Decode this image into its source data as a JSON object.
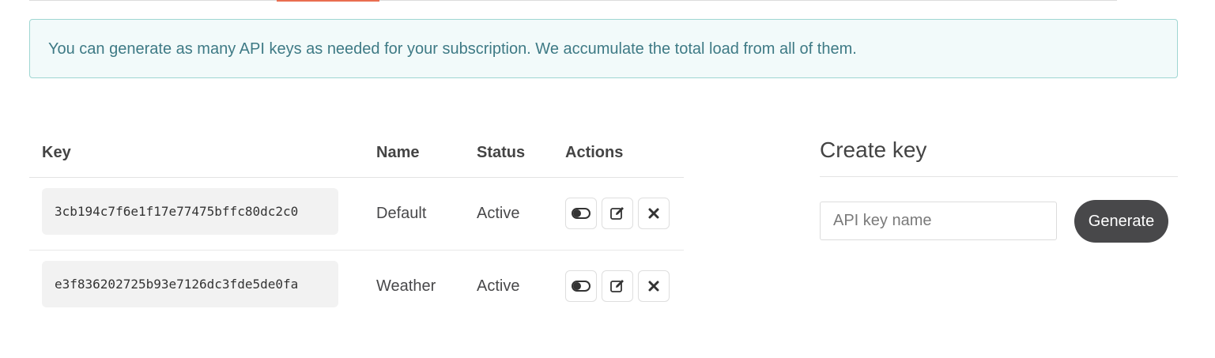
{
  "alert": {
    "message": "You can generate as many API keys as needed for your subscription. We accumulate the total load from all of them."
  },
  "table": {
    "headers": {
      "key": "Key",
      "name": "Name",
      "status": "Status",
      "actions": "Actions"
    },
    "rows": [
      {
        "key": "3cb194c7f6e1f17e77475bffc80dc2c0",
        "name": "Default",
        "status": "Active"
      },
      {
        "key": "e3f836202725b93e7126dc3fde5de0fa",
        "name": "Weather",
        "status": "Active"
      }
    ],
    "row_action_icons": [
      "toggle-icon",
      "edit-icon",
      "close-icon"
    ]
  },
  "create_key": {
    "title": "Create key",
    "input_placeholder": "API key name",
    "input_value": "",
    "generate_label": "Generate"
  },
  "colors": {
    "alert_bg": "#f2fafa",
    "alert_border": "#9fd6d2",
    "alert_text": "#3e7a85",
    "accent_tab": "#e96e50",
    "button_dark": "#48484a"
  }
}
